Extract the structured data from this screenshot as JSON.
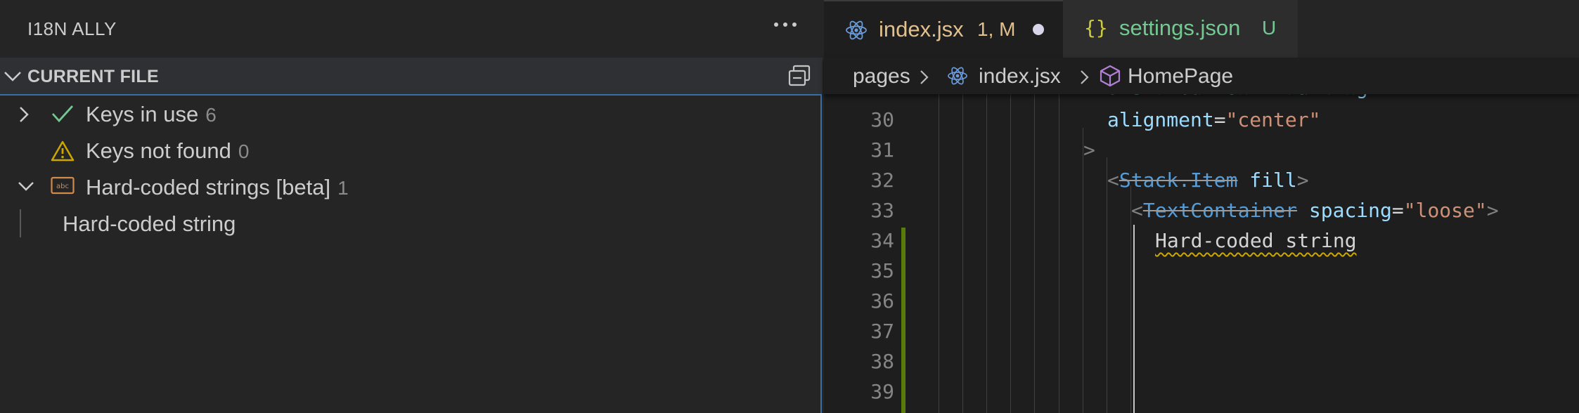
{
  "sidebar": {
    "title": "I18N ALLY",
    "more_icon": "ellipsis-icon",
    "section": {
      "title": "CURRENT FILE",
      "collapse_icon": "collapse-all-icon"
    },
    "items": [
      {
        "label": "Keys in use",
        "count": "6",
        "icon": "check-icon",
        "expanded": false
      },
      {
        "label": "Keys not found",
        "count": "0",
        "icon": "warning-icon"
      },
      {
        "label": "Hard-coded strings [beta]",
        "count": "1",
        "icon": "abc-string-icon",
        "expanded": true
      },
      {
        "label": "Hard-coded string"
      }
    ]
  },
  "editor": {
    "tabs": [
      {
        "filename": "index.jsx",
        "badge": "1, M",
        "icon": "react-icon",
        "active": true,
        "dirty": true,
        "color": "#e2c08d"
      },
      {
        "filename": "settings.json",
        "badge": "U",
        "icon": "json-braces-icon",
        "active": false,
        "color": "#73c991"
      }
    ],
    "breadcrumbs": [
      "pages",
      "index.jsx",
      "HomePage"
    ],
    "lines": [
      {
        "num": "30",
        "text": "alignment=\"center\""
      },
      {
        "num": "31",
        "text": ">"
      },
      {
        "num": "32",
        "text": "<Stack.Item fill>"
      },
      {
        "num": "33",
        "text": "<TextContainer spacing=\"loose\">"
      },
      {
        "num": "34",
        "text": "Hard-coded string"
      },
      {
        "num": "35",
        "text": ""
      },
      {
        "num": "36",
        "text": ""
      },
      {
        "num": "37",
        "text": ""
      },
      {
        "num": "38",
        "text": ""
      },
      {
        "num": "39",
        "text": ""
      }
    ],
    "tokens": {
      "l30_attr": "alignment",
      "l30_eq": "=",
      "l30_str": "\"center\"",
      "l31_punc": ">",
      "l32_open": "<",
      "l32_tag": "Stack.Item",
      "l32_attr": " fill",
      "l32_close": ">",
      "l33_open": "<",
      "l33_tag": "TextContainer",
      "l33_attr": " spacing",
      "l33_eq": "=",
      "l33_str": "\"loose\"",
      "l33_close": ">",
      "l34_text": "Hard-coded string"
    }
  },
  "colors": {
    "sidebar_bg": "#252526",
    "editor_bg": "#1e1e1e",
    "focus_border": "#3a6ea5",
    "git_added": "#587c0c",
    "modified_tab": "#e2c08d",
    "untracked_tab": "#73c991",
    "warning": "#cca700"
  }
}
